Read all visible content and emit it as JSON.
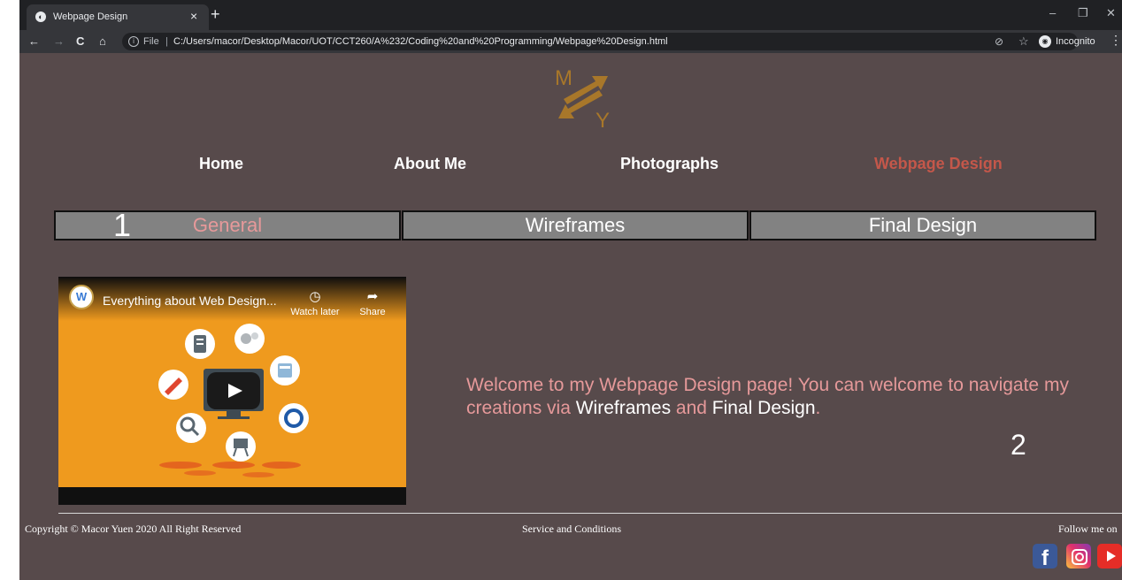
{
  "browser": {
    "tab_title": "Webpage Design",
    "tab_close": "×",
    "new_tab": "+",
    "window_controls": {
      "minimize": "–",
      "restore": "❐",
      "close": "✕"
    },
    "nav": {
      "back": "←",
      "forward": "→",
      "reload": "C",
      "home": "⌂"
    },
    "address": {
      "file_label": "File",
      "separator": "|",
      "url": "C:/Users/macor/Desktop/Macor/UOT/CCT260/A%232/Coding%20and%20Programming/Webpage%20Design.html"
    },
    "incognito_label": "Incognito",
    "icons": [
      "info-icon",
      "eye-off-icon",
      "star-icon",
      "incognito-icon",
      "menu-icon"
    ]
  },
  "site": {
    "logo": {
      "letters": [
        "M",
        "Y"
      ],
      "color": "#a8772a"
    },
    "nav": [
      {
        "label": "Home",
        "active": false
      },
      {
        "label": "About Me",
        "active": false
      },
      {
        "label": "Photographs",
        "active": false
      },
      {
        "label": "Webpage Design",
        "active": true
      }
    ],
    "subtabs": [
      {
        "label": "General",
        "active": true
      },
      {
        "label": "Wireframes",
        "active": false
      },
      {
        "label": "Final Design",
        "active": false
      }
    ],
    "video": {
      "title": "Everything about Web Design...",
      "channel_initial": "W",
      "watch_later": "Watch later",
      "share": "Share"
    },
    "welcome": {
      "lead": "Welcome to my Webpage Design page! You can welcome to navigate my creations via ",
      "link1": "Wireframes",
      "mid": " and ",
      "link2": "Final Design",
      "end": "."
    },
    "footer": {
      "copyright": "Copyright © Macor Yuen 2020 All Right Reserved",
      "terms": "Service and Conditions",
      "follow": "Follow me on"
    },
    "social": [
      "facebook-icon",
      "instagram-icon",
      "youtube-icon"
    ]
  },
  "annotations": {
    "one": "1",
    "two": "2"
  },
  "colors": {
    "page_background": "#574a4b",
    "active_nav": "#c4574a",
    "accent_pink": "#e6999a",
    "subtab_background": "#828282",
    "video_background": "#ef9a1e"
  }
}
